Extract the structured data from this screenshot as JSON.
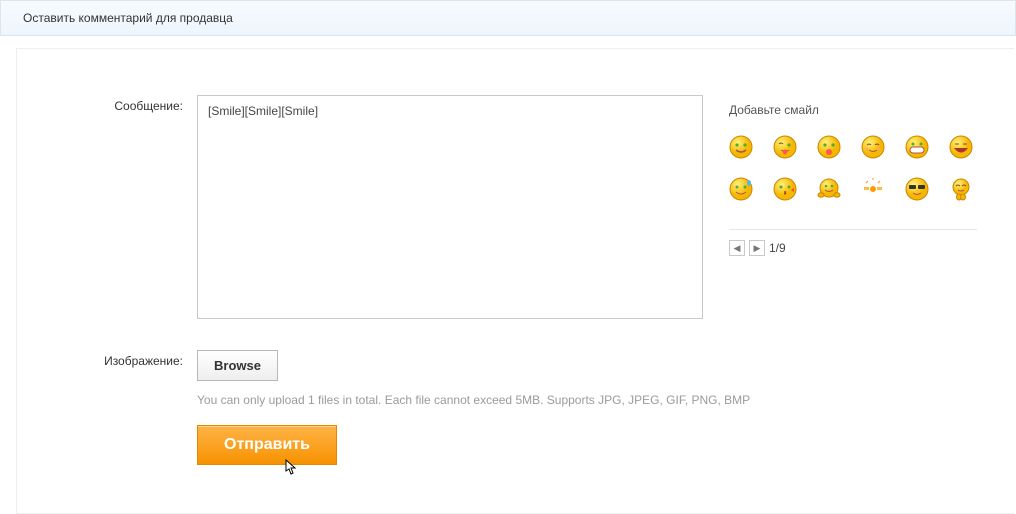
{
  "header": {
    "title": "Оставить комментарий для продавца"
  },
  "form": {
    "message_label": "Сообщение:",
    "message_value": "[Smile][Smile][Smile]",
    "image_label": "Изображение:",
    "browse_label": "Browse",
    "upload_hint": "You can only upload 1 files in total. Each file cannot exceed 5MB. Supports JPG, JPEG, GIF, PNG, BMP",
    "submit_label": "Отправить"
  },
  "emoji": {
    "title": "Добавьте смайл",
    "pager_text": "1/9",
    "items": [
      "smile",
      "tongue-wink",
      "tongue",
      "blush",
      "grin-wide",
      "laugh",
      "sweat-smile",
      "kiss",
      "hug",
      "confetti",
      "cool",
      "pray"
    ]
  }
}
